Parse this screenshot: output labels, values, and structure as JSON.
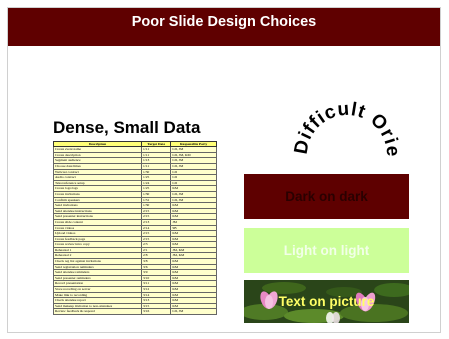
{
  "title": "Poor Slide Design Choices",
  "curved_text": "Difficult Orientation",
  "heading": "Dense, Small Data",
  "table": {
    "headers": [
      "Description",
      "Target Date",
      "Responsible Party"
    ],
    "rows": [
      [
        "Create event name",
        "1/11",
        "LD, JM"
      ],
      [
        "Create description",
        "1/11",
        "LD, JM, KM"
      ],
      [
        "Segment audience",
        "1/13",
        "LD, JM"
      ],
      [
        "Choose date/times",
        "1/11",
        "LD, JM"
      ],
      [
        "Webcast contract",
        "1/30",
        "LD"
      ],
      [
        "Audio contract",
        "1/25",
        "LD"
      ],
      [
        "Teleconference setup",
        "1/24",
        "LD"
      ],
      [
        "Create logo/tags",
        "1/25",
        "KM"
      ],
      [
        "Create invitations",
        "1/30",
        "LD, JM"
      ],
      [
        "Confirm speakers",
        "1/31",
        "LD, JM"
      ],
      [
        "Send invitations",
        "1/30",
        "KM"
      ],
      [
        "Send attendee instructions",
        "2/15",
        "KM"
      ],
      [
        "Send presenter instructions",
        "2/15",
        "KM"
      ],
      [
        "Create slide content",
        "2/13",
        "JM"
      ],
      [
        "Create videos",
        "2/14",
        "SB"
      ],
      [
        "Upload videos",
        "2/15",
        "KM"
      ],
      [
        "Create feedback page",
        "2/15",
        "KM"
      ],
      [
        "Create review intro copy",
        "2/3",
        "KM"
      ],
      [
        "Rehearsal 1",
        "2/1",
        "JM, KM"
      ],
      [
        "Rehearsal 2",
        "2/8",
        "JM, KM"
      ],
      [
        "Check reg list against invitations",
        "3/8",
        "KM"
      ],
      [
        "Send registration reminders",
        "3/6",
        "KM"
      ],
      [
        "Send attendee reminders",
        "3/9",
        "KM"
      ],
      [
        "Send presenter reminders",
        "3/10",
        "KM"
      ],
      [
        "Record presentation",
        "3/11",
        "KM"
      ],
      [
        "Store recording on server",
        "3/12",
        "KM"
      ],
      [
        "Make link to recording",
        "3/14",
        "KM"
      ],
      [
        "Check attendee report",
        "3/13",
        "KM"
      ],
      [
        "Send makeup invitation to non-attendees",
        "3/15",
        "KM"
      ],
      [
        "Review feedback & respond",
        "3/16",
        "LD, JM"
      ]
    ]
  },
  "boxes": {
    "dark": "Dark on dark",
    "light": "Light on light",
    "picture": "Text on picture"
  },
  "colors": {
    "title_bar": "#5f0000",
    "dark_box": "#5e0000",
    "light_box": "#ccff99",
    "table_header": "#ffff77",
    "table_body": "#ffffcc"
  }
}
